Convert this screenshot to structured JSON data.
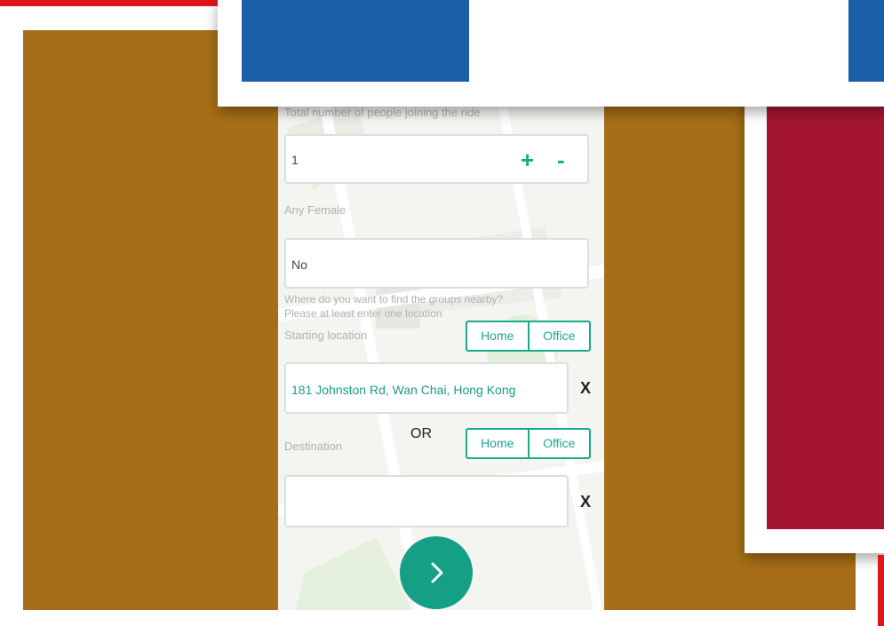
{
  "form": {
    "people_label": "Total number of people joining the ride",
    "people_value": "1",
    "plus_label": "+",
    "minus_label": "-",
    "female_label": "Any Female",
    "female_value": "No",
    "hint_line1": "Where do you want to find the groups nearby?",
    "hint_line2": "Please at least enter one location",
    "start_label": "Starting location",
    "start_value": "181 Johnston Rd, Wan Chai, Hong Kong",
    "start_clear": "X",
    "home_label": "Home",
    "office_label": "Office",
    "or_label": "OR",
    "destination_label": "Destination",
    "destination_value": "",
    "destination_clear": "X",
    "next_icon": "chevron-right-icon"
  },
  "colors": {
    "accent": "#1aab8a",
    "mustard": "#a66f17",
    "crimson": "#a31532",
    "blue": "#1a5ea8",
    "red": "#e01515"
  }
}
